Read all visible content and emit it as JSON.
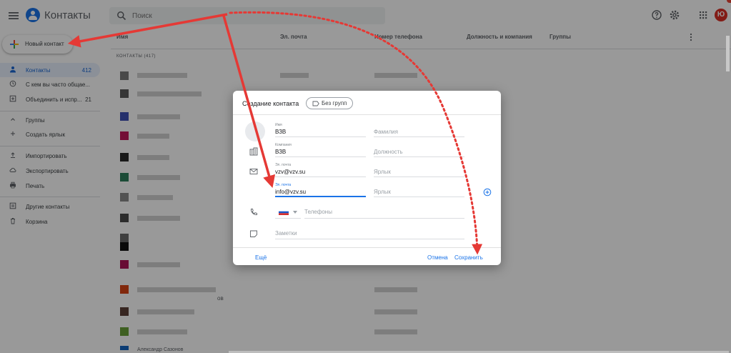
{
  "app": {
    "title": "Контакты",
    "avatar_letter": "Ю"
  },
  "search": {
    "placeholder": "Поиск"
  },
  "sidebar": {
    "new_contact": "Новый контакт",
    "items": [
      {
        "label": "Контакты",
        "count": "412",
        "icon": "person-icon"
      },
      {
        "label": "С кем вы часто общае...",
        "count": "",
        "icon": "history-icon"
      },
      {
        "label": "Объединить и испр...",
        "count": "21",
        "icon": "merge-icon"
      },
      {
        "label": "Группы",
        "count": "",
        "icon": "chevron-up-icon"
      },
      {
        "label": "Создать ярлык",
        "count": "",
        "icon": "add-icon"
      },
      {
        "label": "Импортировать",
        "count": "",
        "icon": "upload-icon"
      },
      {
        "label": "Экспортировать",
        "count": "",
        "icon": "cloud-download-icon"
      },
      {
        "label": "Печать",
        "count": "",
        "icon": "print-icon"
      },
      {
        "label": "Другие контакты",
        "count": "",
        "icon": "other-contacts-icon"
      },
      {
        "label": "Корзина",
        "count": "",
        "icon": "trash-icon"
      }
    ]
  },
  "list": {
    "columns": [
      "Имя",
      "Эл. почта",
      "Номер телефона",
      "Должность и компания",
      "Группы"
    ],
    "section_label": "КОНТАКТЫ (417)",
    "row_fragment": "ов",
    "last_row_name": "Александр Сазонов"
  },
  "dialog": {
    "title": "Создание контакта",
    "group_chip": "Без групп",
    "fields": {
      "first_name": {
        "label": "Имя",
        "value": "ВЗВ"
      },
      "last_name": {
        "placeholder": "Фамилия"
      },
      "company": {
        "label": "Компания",
        "value": "ВЗВ"
      },
      "job_title": {
        "placeholder": "Должность"
      },
      "email1": {
        "label": "Эл. почта",
        "value": "vzv@vzv.su"
      },
      "email1_label": {
        "placeholder": "Ярлык"
      },
      "email2": {
        "label": "Эл. почта",
        "value": "info@vzv.su"
      },
      "email2_label": {
        "placeholder": "Ярлык"
      },
      "phone": {
        "placeholder": "Телефоны"
      },
      "notes": {
        "placeholder": "Заметки"
      }
    },
    "more_button": "Ещё",
    "cancel_button": "Отмена",
    "save_button": "Сохранить"
  },
  "colors": {
    "accent": "#1a73e8",
    "annotation_red": "#e53935",
    "avatar": "#d93025"
  }
}
